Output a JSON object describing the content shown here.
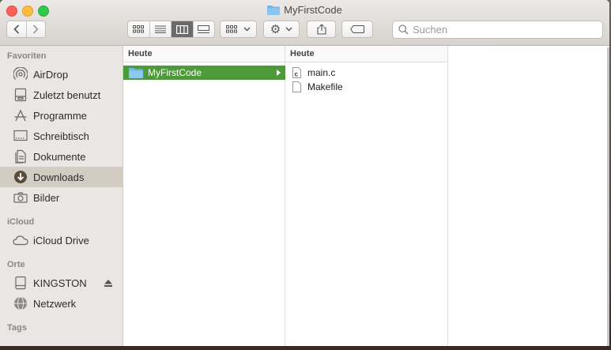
{
  "window": {
    "title": "MyFirstCode"
  },
  "toolbar": {
    "nav": {
      "back": "back",
      "forward": "forward"
    },
    "view_modes": [
      "icon-view",
      "list-view",
      "column-view",
      "gallery-view"
    ],
    "search_placeholder": "Suchen"
  },
  "sidebar": {
    "favorites_header": "Favoriten",
    "favorites": [
      {
        "label": "AirDrop",
        "icon": "airdrop-icon"
      },
      {
        "label": "Zuletzt benutzt",
        "icon": "recents-icon"
      },
      {
        "label": "Programme",
        "icon": "applications-icon"
      },
      {
        "label": "Schreibtisch",
        "icon": "desktop-icon"
      },
      {
        "label": "Dokumente",
        "icon": "documents-icon"
      },
      {
        "label": "Downloads",
        "icon": "downloads-icon",
        "selected": true
      },
      {
        "label": "Bilder",
        "icon": "pictures-icon"
      }
    ],
    "icloud_header": "iCloud",
    "icloud": [
      {
        "label": "iCloud Drive",
        "icon": "cloud-icon"
      }
    ],
    "places_header": "Orte",
    "places": [
      {
        "label": "KINGSTON",
        "icon": "drive-icon"
      },
      {
        "label": "Netzwerk",
        "icon": "network-icon"
      }
    ],
    "tags_header": "Tags"
  },
  "columns": [
    {
      "header": "Heute",
      "items": [
        {
          "name": "MyFirstCode",
          "type": "folder",
          "selected": true
        }
      ]
    },
    {
      "header": "Heute",
      "items": [
        {
          "name": "main.c",
          "type": "c-file"
        },
        {
          "name": "Makefile",
          "type": "file"
        }
      ]
    }
  ],
  "colors": {
    "selection": "#4d9a3b",
    "sidebar_selected": "#d3ccc2",
    "folder": "#6fb6e6"
  }
}
